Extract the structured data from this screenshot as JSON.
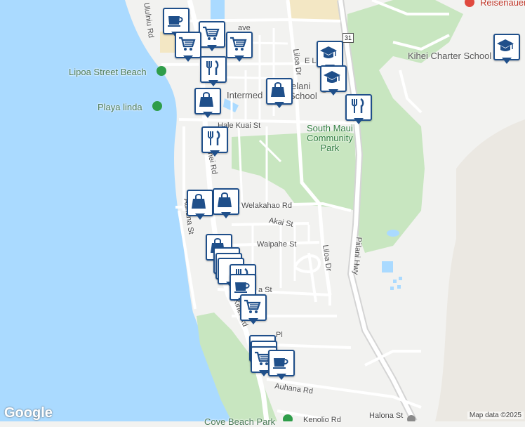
{
  "map": {
    "colors": {
      "water": "#aadaff",
      "land": "#f2f2f0",
      "park": "#c8e6c0",
      "road": "#ffffff",
      "highway": "#dadada",
      "marker": "#1f4f8a",
      "school": "#f3e7c4"
    },
    "roads": {
      "uluniu": "Ululniu Rd",
      "lipoa_ave": "ave",
      "liloa_upper": "Liloa Dr",
      "e_l": "E L",
      "hale_kuai": "Hale Kuai St",
      "welakahao": "Welakahao Rd",
      "akai": "Akai St",
      "waipahe": "Waipahe St",
      "liloa_lower": "Liloa Dr",
      "piilani": "Piilani Hwy",
      "kihei_upper": "hei Rd",
      "kihei_lower": "Kihei Rd",
      "auhana_st": "Auhana St",
      "auhana_rd": "Auhana Rd",
      "halona": "Halona St",
      "kenolio": "a St",
      "lane_pl": "Pl",
      "kenolio_lower": "Kenolio Rd",
      "hwy_shield": "31"
    },
    "places": {
      "lipoa_beach": "Lipoa Street Beach",
      "playa_linda": "Playa linda",
      "intermediate": "Intermed",
      "lokelani": "elani",
      "school_suffix": "School",
      "south_maui_park": "South Maui\nCommunity\nPark",
      "kihei_charter": "Kihei Charter School",
      "reisenauer": "Reisenauer",
      "cove_beach": "Cove Beach Park"
    },
    "icons": [
      "coffee-icon",
      "shopping-cart-icon",
      "shopping-cart-icon",
      "shopping-cart-icon",
      "restaurant-icon",
      "school-icon",
      "school-icon",
      "school-icon",
      "shopping-bag-icon",
      "shopping-bag-icon",
      "restaurant-icon",
      "restaurant-icon",
      "shopping-bag-icon",
      "shopping-bag-icon",
      "shopping-bag-icon",
      "restaurant-icon",
      "coffee-icon",
      "shopping-cart-icon",
      "shopping-cart-icon",
      "coffee-icon"
    ],
    "branding": {
      "logo": "Google",
      "attribution": "Map data ©2025"
    }
  }
}
